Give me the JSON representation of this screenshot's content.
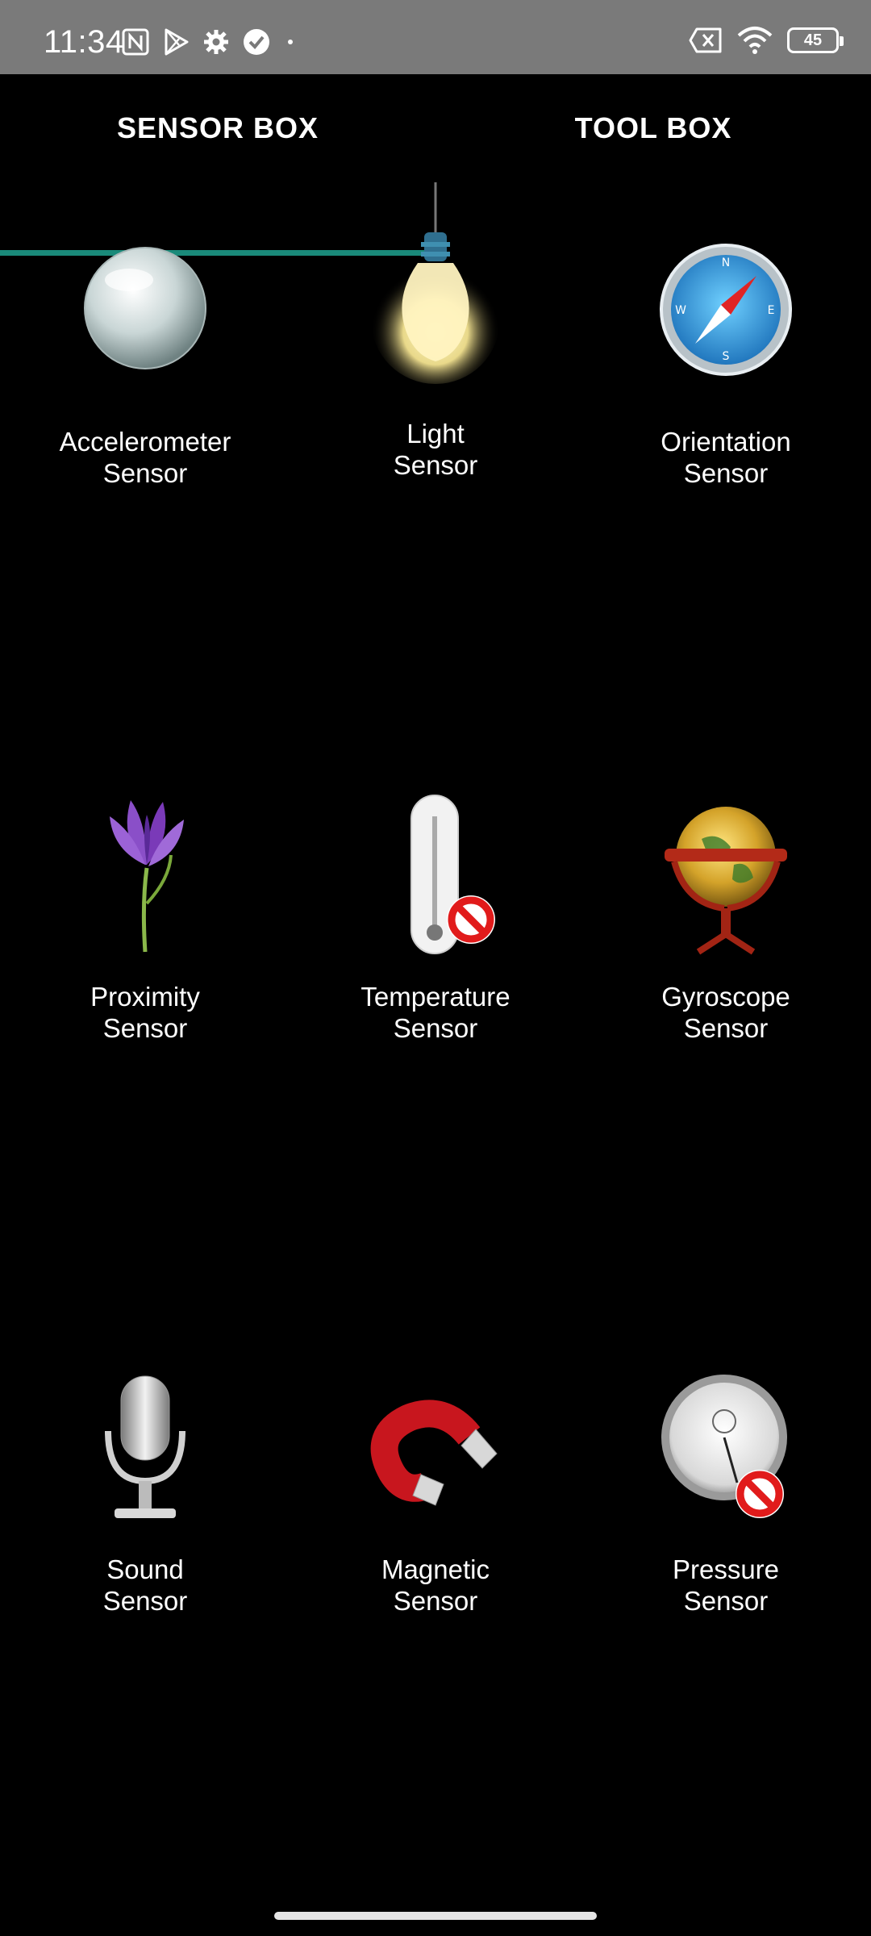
{
  "status_bar": {
    "time": "11:34",
    "battery_level": "45",
    "icons": [
      "nfc-icon",
      "play-store-icon",
      "settings-gear-icon",
      "check-circle-icon",
      "dot-icon",
      "data-off-icon",
      "wifi-icon",
      "battery-icon"
    ]
  },
  "tabs": [
    {
      "label": "SENSOR BOX",
      "selected": true
    },
    {
      "label": "TOOL BOX",
      "selected": false
    }
  ],
  "accent_color": "#1a8a7a",
  "sensors": [
    {
      "line1": "Accelerometer",
      "line2": "Sensor",
      "icon": "glass-ball-icon",
      "unavailable": false
    },
    {
      "line1": "Light",
      "line2": "Sensor",
      "icon": "light-bulb-icon",
      "unavailable": false
    },
    {
      "line1": "Orientation",
      "line2": "Sensor",
      "icon": "compass-icon",
      "unavailable": false
    },
    {
      "line1": "Proximity",
      "line2": "Sensor",
      "icon": "flower-icon",
      "unavailable": false
    },
    {
      "line1": "Temperature",
      "line2": "Sensor",
      "icon": "thermometer-icon",
      "unavailable": true
    },
    {
      "line1": "Gyroscope",
      "line2": "Sensor",
      "icon": "globe-gyroscope-icon",
      "unavailable": false
    },
    {
      "line1": "Sound",
      "line2": "Sensor",
      "icon": "microphone-icon",
      "unavailable": false
    },
    {
      "line1": "Magnetic",
      "line2": "Sensor",
      "icon": "magnet-icon",
      "unavailable": false
    },
    {
      "line1": "Pressure",
      "line2": "Sensor",
      "icon": "stopwatch-gauge-icon",
      "unavailable": true
    }
  ]
}
